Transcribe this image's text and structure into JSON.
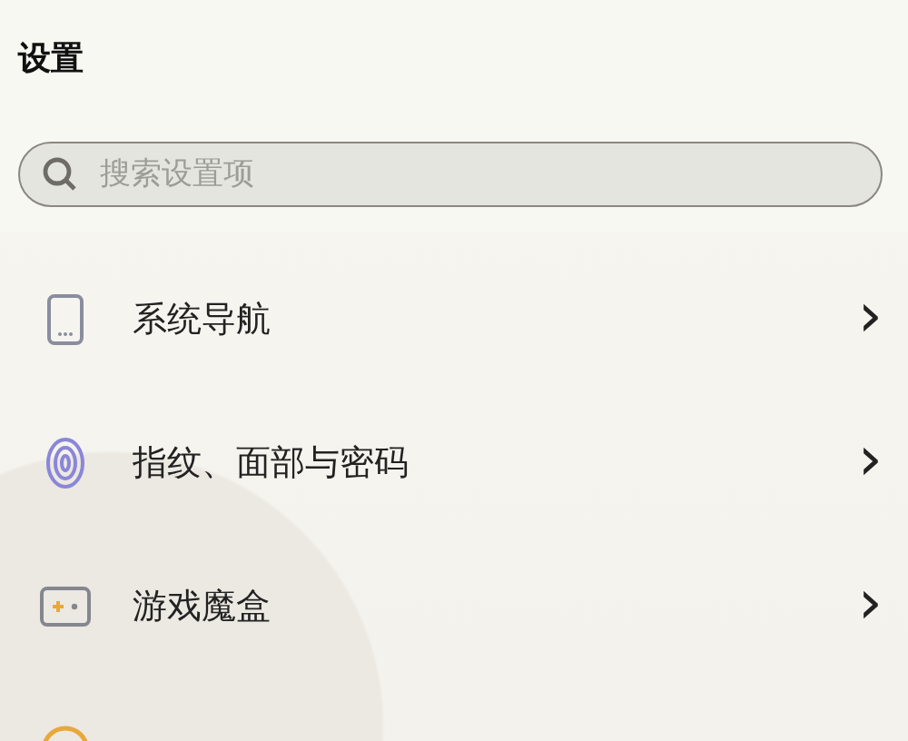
{
  "title": "设置",
  "search": {
    "placeholder": "搜索设置项"
  },
  "items": [
    {
      "kind": "phone",
      "label": "系统导航",
      "chevron": "›"
    },
    {
      "kind": "fingerprint",
      "label": "指纹、面部与密码",
      "chevron": "›"
    },
    {
      "kind": "gamepad",
      "label": "游戏魔盒",
      "chevron": "›"
    },
    {
      "kind": "circle"
    }
  ]
}
